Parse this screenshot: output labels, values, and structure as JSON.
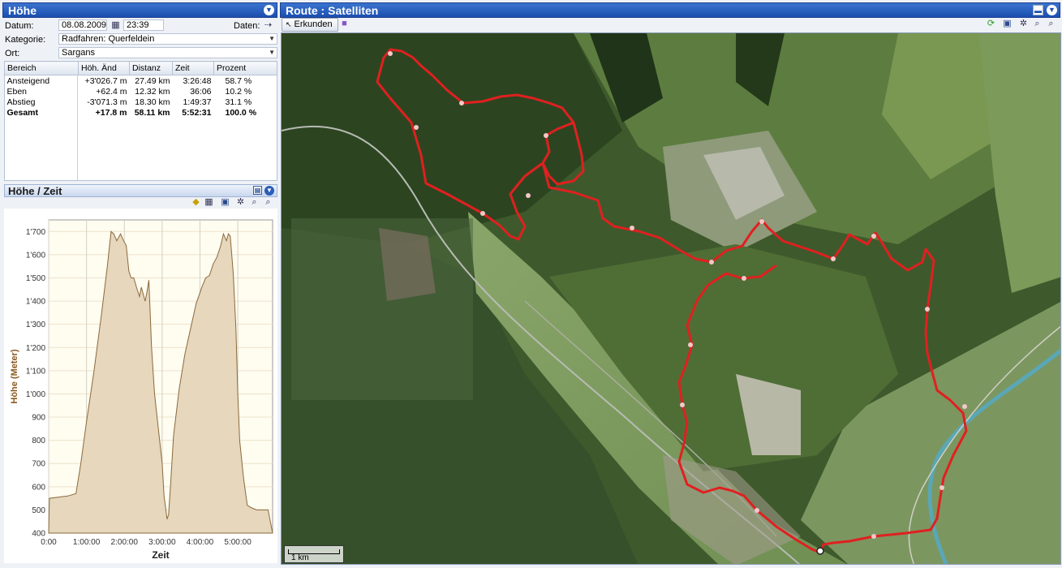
{
  "left_panel": {
    "title": "Höhe",
    "datum_label": "Datum:",
    "datum_value": "08.08.2009",
    "time_value": "23:39",
    "daten_label": "Daten:",
    "kategorie_label": "Kategorie:",
    "kategorie_value": "Radfahren: Querfeldein",
    "ort_label": "Ort:",
    "ort_value": "Sargans"
  },
  "table": {
    "headers": [
      "Bereich",
      "Höh. Änd",
      "Distanz",
      "Zeit",
      "Prozent"
    ],
    "rows": [
      {
        "bereich": "Ansteigend",
        "hoehe": "+3'026.7 m",
        "distanz": "27.49 km",
        "zeit": "3:26:48",
        "prozent": "58.7 %"
      },
      {
        "bereich": "Eben",
        "hoehe": "+62.4 m",
        "distanz": "12.32 km",
        "zeit": "36:06",
        "prozent": "10.2 %"
      },
      {
        "bereich": "Abstieg",
        "hoehe": "-3'071.3 m",
        "distanz": "18.30 km",
        "zeit": "1:49:37",
        "prozent": "31.1 %"
      },
      {
        "bereich": "Gesamt",
        "hoehe": "+17.8 m",
        "distanz": "58.11 km",
        "zeit": "5:52:31",
        "prozent": "100.0 %"
      }
    ]
  },
  "chart_panel": {
    "title": "Höhe / Zeit"
  },
  "chart_data": {
    "type": "area",
    "title": "",
    "xlabel": "Zeit",
    "ylabel": "Höhe (Meter)",
    "xlim": [
      0,
      5.92
    ],
    "ylim": [
      400,
      1750
    ],
    "x_ticks": [
      0,
      1,
      2,
      3,
      4,
      5
    ],
    "x_tick_labels": [
      "0:00",
      "1:00:00",
      "2:00:00",
      "3:00:00",
      "4:00:00",
      "5:00:00"
    ],
    "y_ticks": [
      400,
      500,
      600,
      700,
      800,
      900,
      1000,
      1100,
      1200,
      1300,
      1400,
      1500,
      1600,
      1700
    ],
    "y_tick_labels": [
      "400",
      "500",
      "600",
      "700",
      "800",
      "900",
      "1'000",
      "1'100",
      "1'200",
      "1'300",
      "1'400",
      "1'500",
      "1'600",
      "1'700"
    ],
    "grid": true,
    "fill_color": "#e6d7bd",
    "line_color": "#8a6a3c",
    "series": [
      {
        "x": [
          0,
          0.02,
          0.5,
          0.72,
          0.85,
          1.0,
          1.2,
          1.4,
          1.55,
          1.65,
          1.72,
          1.8,
          1.9,
          1.98,
          2.05,
          2.12,
          2.18,
          2.25,
          2.32,
          2.4,
          2.45,
          2.55,
          2.6,
          2.65,
          2.72,
          2.8,
          2.9,
          3.0,
          3.05,
          3.1,
          3.13,
          3.17,
          3.22,
          3.3,
          3.45,
          3.6,
          3.75,
          3.9,
          4.05,
          4.15,
          4.25,
          4.35,
          4.45,
          4.55,
          4.62,
          4.7,
          4.75,
          4.8,
          4.88,
          4.95,
          5.0,
          5.05,
          5.15,
          5.25,
          5.35,
          5.42,
          5.5,
          5.58,
          5.7,
          5.8,
          5.92
        ],
        "y": [
          400,
          550,
          560,
          570,
          700,
          880,
          1100,
          1350,
          1550,
          1700,
          1690,
          1660,
          1690,
          1660,
          1640,
          1530,
          1500,
          1500,
          1460,
          1420,
          1460,
          1400,
          1440,
          1490,
          1200,
          1000,
          850,
          700,
          560,
          500,
          460,
          480,
          600,
          820,
          1020,
          1170,
          1280,
          1390,
          1460,
          1500,
          1510,
          1560,
          1590,
          1640,
          1690,
          1660,
          1690,
          1680,
          1520,
          1280,
          1000,
          800,
          640,
          520,
          510,
          505,
          500,
          500,
          500,
          500,
          400
        ]
      }
    ]
  },
  "map_panel": {
    "title": "Route : Satelliten",
    "erkunden_label": "Erkunden",
    "scale_label": "1 km",
    "route_color": "#e02020"
  }
}
